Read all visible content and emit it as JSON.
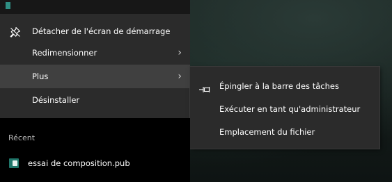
{
  "context_menu": {
    "items": [
      {
        "label": "Détacher de l'écran de démarrage",
        "icon": "unpin-icon",
        "has_submenu": false
      },
      {
        "label": "Redimensionner",
        "has_submenu": true
      },
      {
        "label": "Plus",
        "has_submenu": true,
        "hovered": true
      },
      {
        "label": "Désinstaller",
        "has_submenu": false
      }
    ],
    "chevron_glyph": "›"
  },
  "submenu": {
    "items": [
      {
        "label": "Épingler à la barre des tâches",
        "icon": "pin-taskbar-icon"
      },
      {
        "label": "Exécuter en tant qu'administrateur"
      },
      {
        "label": "Emplacement du fichier"
      }
    ]
  },
  "recent": {
    "heading": "Récent",
    "items": [
      {
        "label": "essai de composition.pub",
        "icon": "publisher-file-icon"
      }
    ]
  },
  "colors": {
    "menu_bg": "#2b2b2b",
    "hover_bg": "#404040",
    "recent_bg": "#000000",
    "accent_teal": "#2f8f84"
  }
}
